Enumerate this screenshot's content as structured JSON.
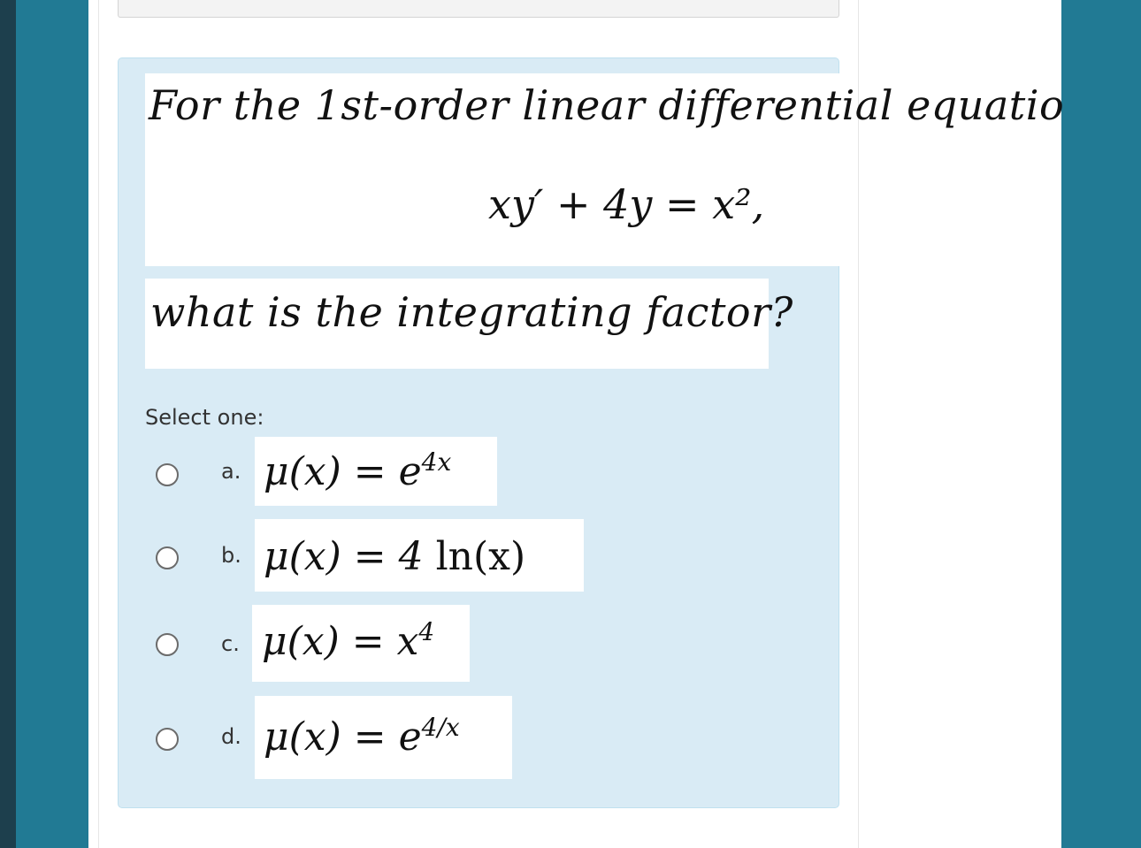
{
  "question": {
    "intro": "For the 1st-order linear differential equatio",
    "equation": "xy′ + 4y = x²,",
    "prompt": "what is the integrating factor?"
  },
  "select_label": "Select one:",
  "options": [
    {
      "letter": "a.",
      "lhs": "μ(x) = e",
      "sup": "4x",
      "suffix": ""
    },
    {
      "letter": "b.",
      "lhs": "μ(x) = 4",
      "sup": "",
      "suffix": "ln(x)"
    },
    {
      "letter": "c.",
      "lhs": "μ(x) = x",
      "sup": "4",
      "suffix": ""
    },
    {
      "letter": "d.",
      "lhs": "μ(x) = e",
      "sup": "4/x",
      "suffix": ""
    }
  ],
  "colors": {
    "background": "#217a94",
    "question_box": "#d9ebf5",
    "panel": "#ffffff"
  }
}
